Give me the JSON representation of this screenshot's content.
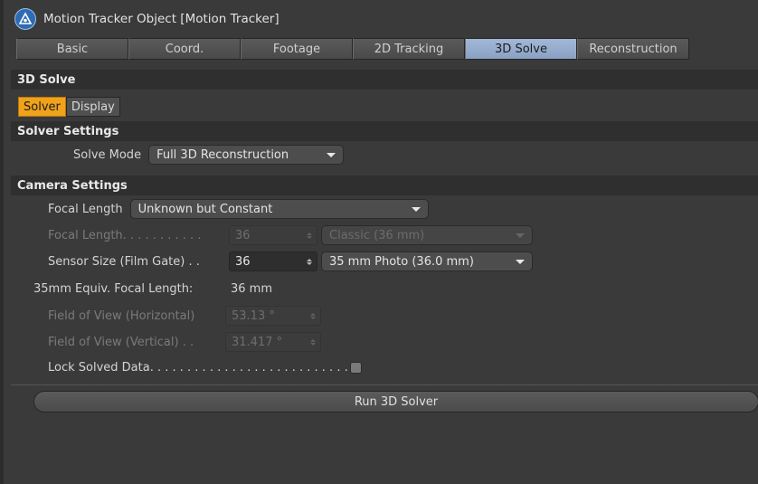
{
  "window": {
    "title": "Motion Tracker Object [Motion Tracker]"
  },
  "tabs": [
    {
      "label": "Basic",
      "active": false
    },
    {
      "label": "Coord.",
      "active": false
    },
    {
      "label": "Footage",
      "active": false
    },
    {
      "label": "2D Tracking",
      "active": false
    },
    {
      "label": "3D Solve",
      "active": true
    },
    {
      "label": "Reconstruction",
      "active": false
    }
  ],
  "section_title": "3D Solve",
  "subtabs": [
    {
      "label": "Solver",
      "active": true
    },
    {
      "label": "Display",
      "active": false
    }
  ],
  "solver_settings": {
    "header": "Solver Settings",
    "solve_mode_label": "Solve Mode",
    "solve_mode_value": "Full 3D Reconstruction"
  },
  "camera_settings": {
    "header": "Camera Settings",
    "focal_length_mode_label": "Focal Length",
    "focal_length_mode_value": "Unknown but Constant",
    "focal_length_label": "Focal Length. . . . . . . . . . .",
    "focal_length_value": "36",
    "focal_length_preset": "Classic (36 mm)",
    "sensor_size_label": "Sensor Size (Film Gate) . .",
    "sensor_size_value": "36",
    "sensor_size_preset": "35 mm Photo (36.0 mm)",
    "equiv_label": "35mm Equiv. Focal Length:",
    "equiv_value": "36 mm",
    "fov_h_label": "Field of View (Horizontal)",
    "fov_h_value": "53.13 °",
    "fov_v_label": "Field of View (Vertical) . .",
    "fov_v_value": "31.417 °",
    "lock_label": "Lock Solved Data. . . . . . . . . . . . . . . . . . . . . . . . . . .",
    "lock_checked": false
  },
  "run_button": {
    "label": "Run 3D Solver"
  },
  "colors": {
    "active_tab": "#8aa1c4",
    "active_subtab": "#f0a21b",
    "panel_bg": "#3a3a3a",
    "section_bg": "#2f2f2f"
  },
  "icons": {
    "object_icon": "motion-tracker-icon"
  }
}
